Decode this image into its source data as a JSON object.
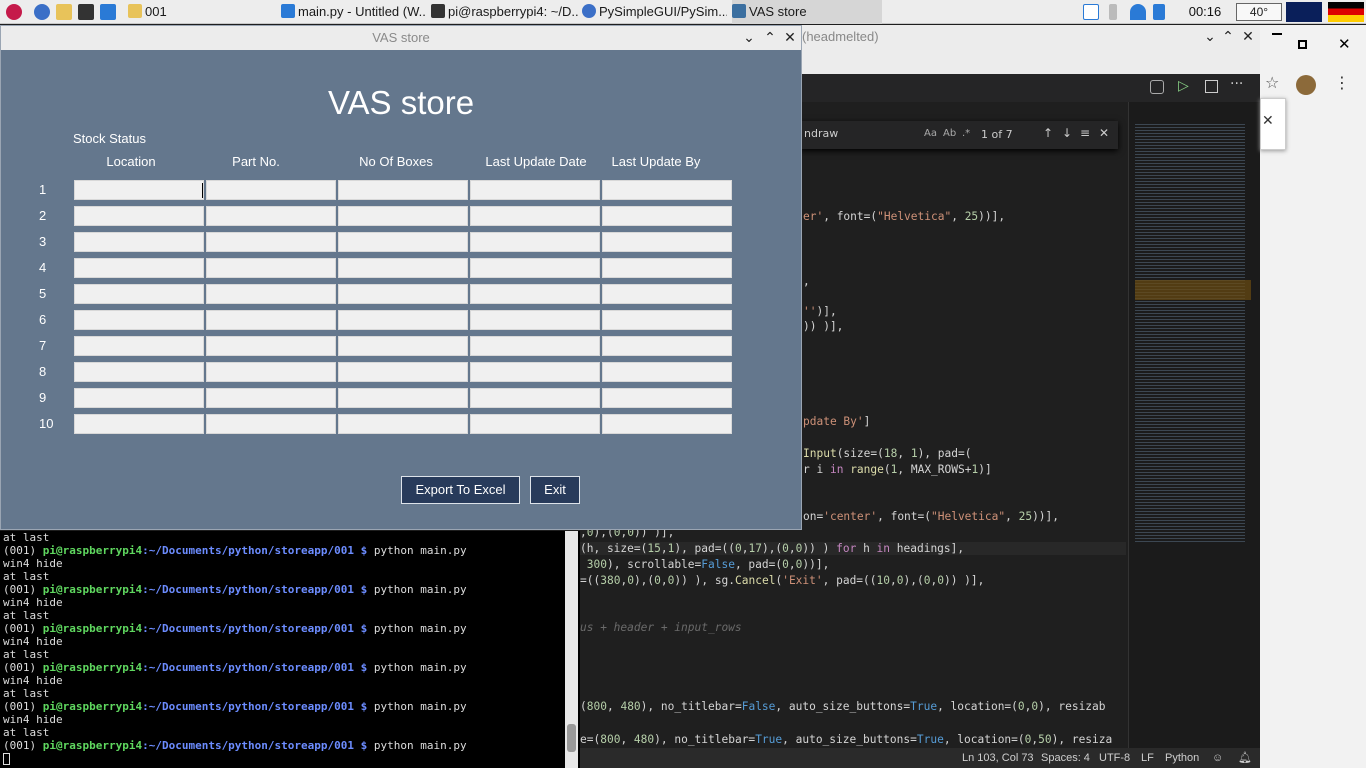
{
  "taskbar": {
    "folder_label": "001",
    "tasks": [
      {
        "label": "main.py - Untitled (W..."
      },
      {
        "label": "pi@raspberrypi4: ~/D..."
      },
      {
        "label": "PySimpleGUI/PySim..."
      },
      {
        "label": "VAS store"
      }
    ],
    "clock": "00:16",
    "temperature": "40°"
  },
  "vas_window": {
    "title": "VAS store",
    "heading": "VAS store",
    "section_label": "Stock Status",
    "headings": [
      "Location",
      "Part No.",
      "No Of Boxes",
      "Last Update Date",
      "Last Update By"
    ],
    "row_numbers": [
      "1",
      "2",
      "3",
      "4",
      "5",
      "6",
      "7",
      "8",
      "9",
      "10"
    ],
    "export_button": "Export To Excel",
    "exit_button": "Exit"
  },
  "editor": {
    "title_suffix": "(headmelted)",
    "find_query": "ndraw",
    "find_count": "1 of 7",
    "status": {
      "position": "Ln 103, Col 73",
      "spaces": "Spaces: 4",
      "encoding": "UTF-8",
      "eol": "LF",
      "language": "Python"
    }
  },
  "terminal": {
    "first_line": "at last",
    "prompt_env": "(001)",
    "prompt_host": "pi@raspberrypi4",
    "prompt_path": ":~/Documents/python/storeapp/001 $",
    "command": " python main.py",
    "output_1": "win4 hide",
    "output_2": "at last"
  },
  "colors": {
    "window_bg": "#64778d",
    "button_bg": "#283b5b",
    "terminal_green": "#5fd75f",
    "terminal_blue": "#6c8cff"
  }
}
